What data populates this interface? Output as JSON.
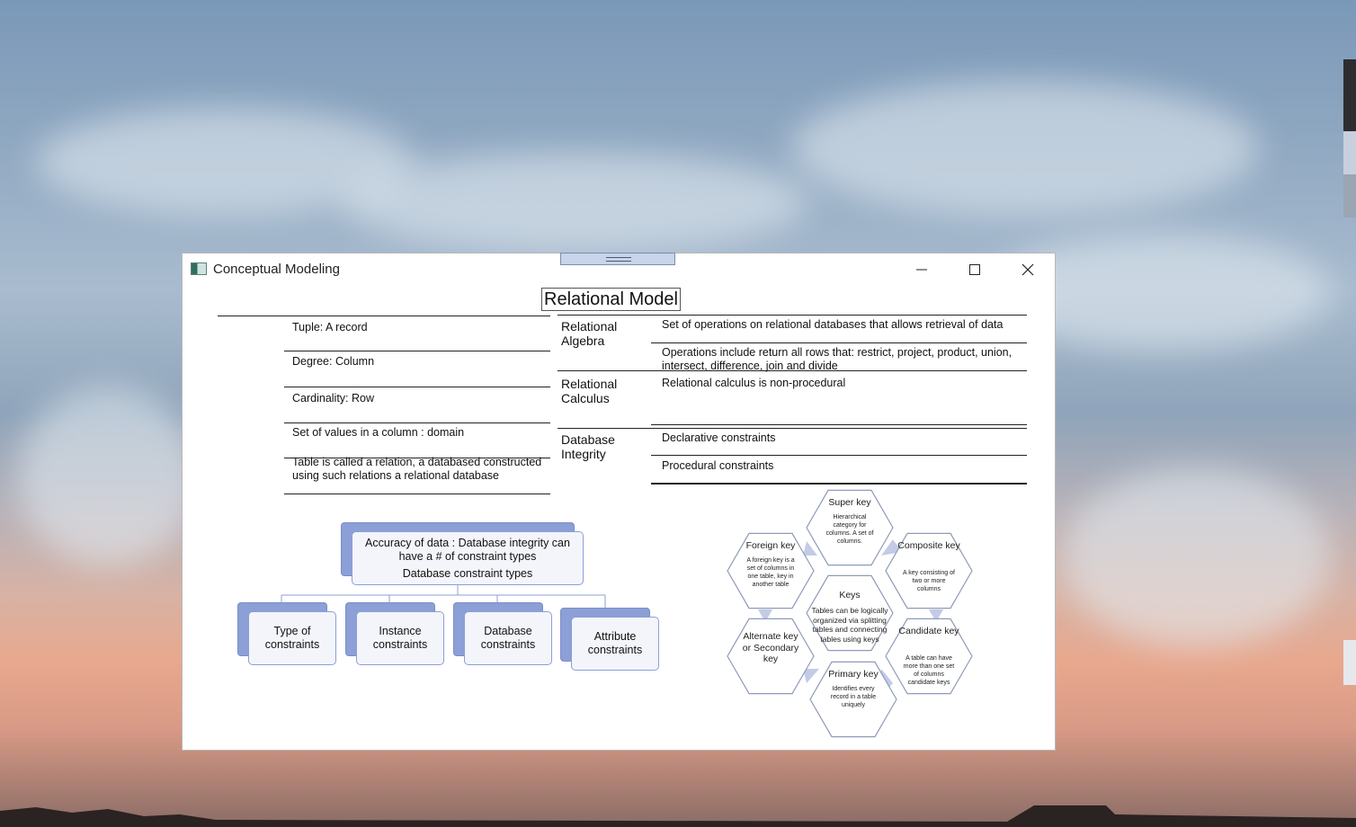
{
  "window": {
    "title": "Conceptual Modeling",
    "controls": {
      "minimize": "—",
      "maximize": "☐",
      "close": "✕"
    }
  },
  "document": {
    "title": "Relational Model",
    "definitions": [
      "Tuple: A record",
      "Degree: Column",
      "Cardinality: Row",
      "Set of values in a column : domain",
      "Table is called  a relation, a databased constructed using such relations a relational database"
    ],
    "topics": [
      {
        "name": "Relational Algebra",
        "items": [
          "Set of operations on relational databases that allows retrieval of data",
          "Operations include  return all rows that: restrict, project, product, union, intersect, difference, join and divide"
        ]
      },
      {
        "name": "Relational Calculus",
        "items": [
          "Relational calculus is non-procedural"
        ]
      },
      {
        "name": "Database Integrity",
        "items": [
          "Declarative constraints",
          "Procedural constraints"
        ]
      }
    ],
    "org_chart": {
      "root": "Accuracy of data : Database integrity can have a # of constraint types",
      "root_sub": "Database constraint types",
      "children": [
        "Type of constraints",
        "Instance constraints",
        "Database constraints",
        "Attribute constraints"
      ]
    },
    "keys_diagram": {
      "center": {
        "title": "Keys",
        "text": "Tables can be logically organized via splitting tables and connecting tables using keys"
      },
      "items": [
        {
          "title": "Super key",
          "text": "Hierarchical category for columns. A set of columns."
        },
        {
          "title": "Composite key",
          "text": "A key consisting of two or more columns"
        },
        {
          "title": "Candidate key",
          "text": "A table can have more than one set of columns candidate keys"
        },
        {
          "title": "Primary key",
          "text": "Identifies every record in a table uniquely"
        },
        {
          "title": "Alternate key or Secondary key",
          "text": ""
        },
        {
          "title": "Foreign key",
          "text": "A foreign key is a set of columns in one table, key in another table"
        }
      ]
    }
  },
  "colors": {
    "hex_stroke": "#8e9bb8",
    "hex_accent": "#c3cbe6",
    "box_back": "#8c9fd6",
    "box_front": "#f3f5fb"
  }
}
